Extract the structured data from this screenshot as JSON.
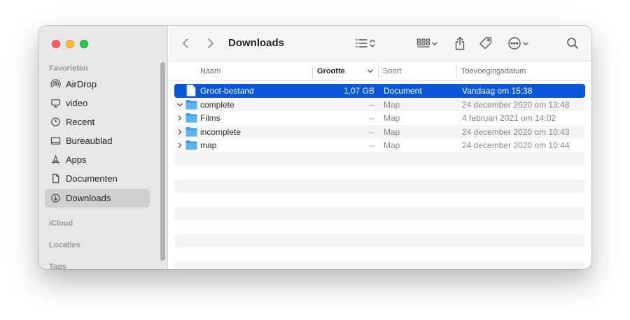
{
  "window": {
    "title": "Downloads"
  },
  "sidebar": {
    "sections": {
      "favorieten": "Favorieten",
      "icloud": "iCloud",
      "locaties": "Locaties",
      "tags": "Tags"
    },
    "items": [
      {
        "label": "AirDrop",
        "icon": "airdrop-icon"
      },
      {
        "label": "video",
        "icon": "display-icon"
      },
      {
        "label": "Recent",
        "icon": "clock-icon"
      },
      {
        "label": "Bureaublad",
        "icon": "desktop-icon"
      },
      {
        "label": "Apps",
        "icon": "apps-icon"
      },
      {
        "label": "Documenten",
        "icon": "document-icon"
      },
      {
        "label": "Downloads",
        "icon": "download-icon",
        "selected": true
      }
    ]
  },
  "columns": {
    "name": "Naam",
    "size": "Grootte",
    "kind": "Soort",
    "date_added": "Toevoegingsdatum"
  },
  "files": [
    {
      "name": "Groot-bestand",
      "size": "1,07 GB",
      "kind": "Document",
      "date": "Vandaag om 15:38",
      "type": "file",
      "selected": true
    },
    {
      "name": "complete",
      "size": "--",
      "kind": "Map",
      "date": "24 december 2020 om 13:48",
      "type": "folder",
      "expanded": true
    },
    {
      "name": "Films",
      "size": "--",
      "kind": "Map",
      "date": "4 februari 2021 om 14:02",
      "type": "folder"
    },
    {
      "name": "incomplete",
      "size": "--",
      "kind": "Map",
      "date": "24 december 2020 om 10:43",
      "type": "folder"
    },
    {
      "name": "map",
      "size": "--",
      "kind": "Map",
      "date": "24 december 2020 om 10:44",
      "type": "folder"
    }
  ],
  "colors": {
    "selection": "#0a58d8",
    "folder": "#4aa7f0",
    "close": "#ff5f57",
    "minimize": "#febc2e",
    "zoom": "#28c840"
  }
}
